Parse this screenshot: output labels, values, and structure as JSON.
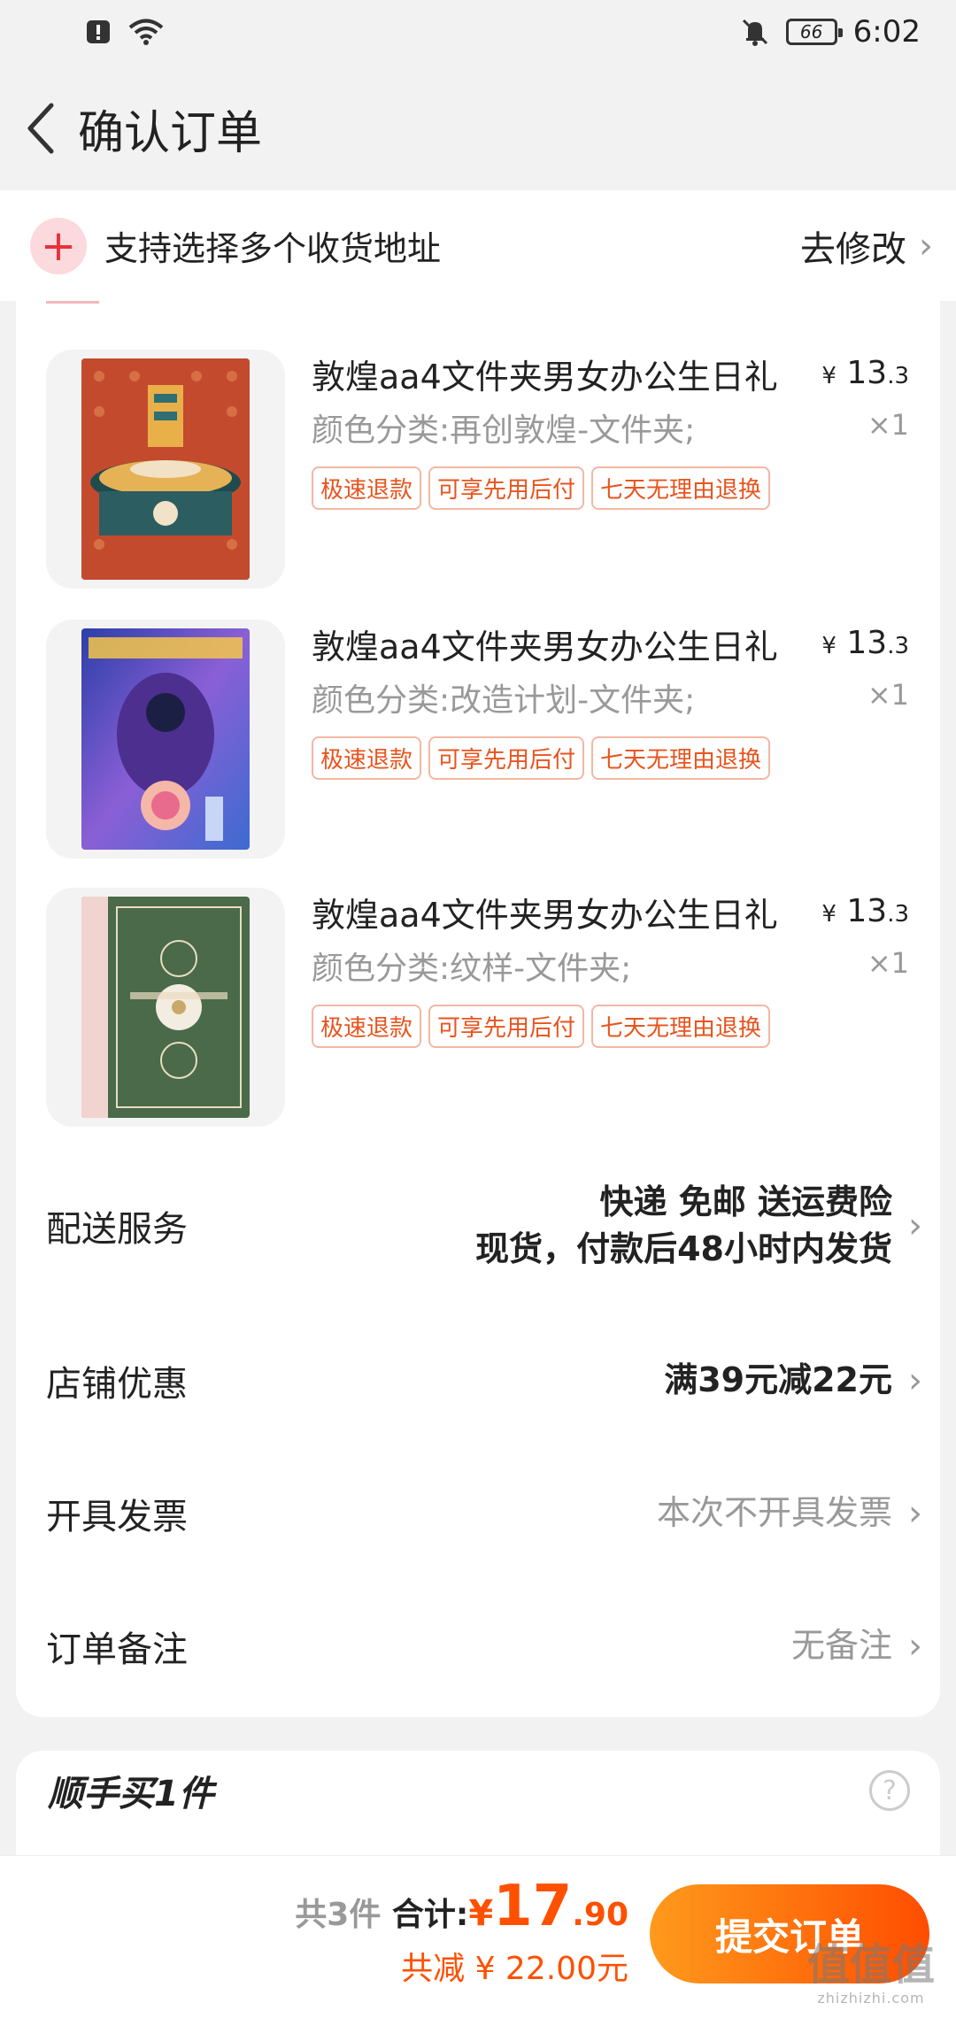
{
  "status_bar": {
    "time": "6:02",
    "battery": "66",
    "icons": [
      "alert-icon",
      "wifi-icon",
      "mute-icon",
      "battery-icon"
    ]
  },
  "nav": {
    "title": "确认订单",
    "back_icon": "chevron-left-icon"
  },
  "address": {
    "text": "支持选择多个收货地址",
    "edit_label": "去修改"
  },
  "products": [
    {
      "title": "敦煌aa4文件夹男女办公生日礼",
      "price_yen": "¥",
      "price_int": "13",
      "price_dec": ".3",
      "sku": "颜色分类:再创敦煌-文件夹;",
      "qty": "×1",
      "tags": [
        "极速退款",
        "可享先用后付",
        "七天无理由退换"
      ]
    },
    {
      "title": "敦煌aa4文件夹男女办公生日礼",
      "price_yen": "¥",
      "price_int": "13",
      "price_dec": ".3",
      "sku": "颜色分类:改造计划-文件夹;",
      "qty": "×1",
      "tags": [
        "极速退款",
        "可享先用后付",
        "七天无理由退换"
      ]
    },
    {
      "title": "敦煌aa4文件夹男女办公生日礼",
      "price_yen": "¥",
      "price_int": "13",
      "price_dec": ".3",
      "sku": "颜色分类:纹样-文件夹;",
      "qty": "×1",
      "tags": [
        "极速退款",
        "可享先用后付",
        "七天无理由退换"
      ]
    }
  ],
  "rows": {
    "delivery": {
      "label": "配送服务",
      "line1": "快递 免邮 送运费险",
      "line2": "现货，付款后48小时内发货"
    },
    "discount": {
      "label": "店铺优惠",
      "value": "满39元减22元"
    },
    "invoice": {
      "label": "开具发票",
      "value": "本次不开具发票"
    },
    "remark": {
      "label": "订单备注",
      "value": "无备注"
    }
  },
  "addon": {
    "title": "顺手买1件",
    "help_icon": "question-icon"
  },
  "bottom": {
    "count": "共3件",
    "total_label": "合计:",
    "total_yen": "¥",
    "total_int": "17",
    "total_dec": ".90",
    "saved": "共减 ¥ 22.00元",
    "submit_label": "提交订单"
  },
  "watermark": {
    "text": "值值值",
    "sub": "zhizhizhi.com"
  },
  "colors": {
    "accent": "#ff5000",
    "tag_text": "#e8541e",
    "plus": "#e8323c"
  }
}
